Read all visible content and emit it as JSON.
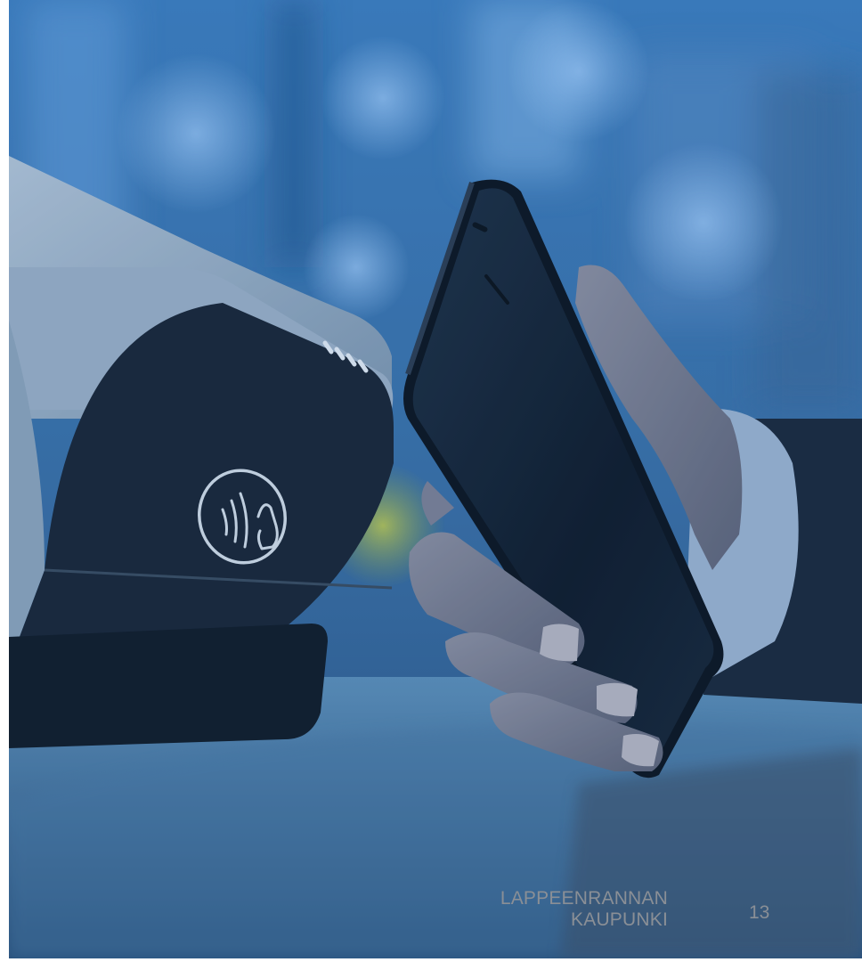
{
  "slide": {
    "footer": {
      "org_line1": "LAPPEENRANNAN",
      "org_line2": "KAUPUNKI",
      "page_number": "13"
    },
    "photo": {
      "subject": "contactless-mobile-payment",
      "icons": [
        "contactless-payment-icon"
      ],
      "tint_color": "#1e5a96"
    }
  }
}
